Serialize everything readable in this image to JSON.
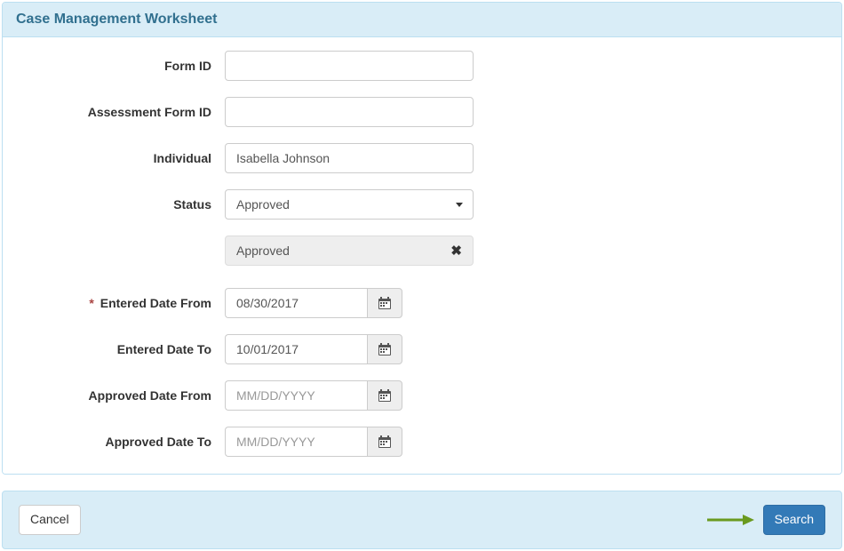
{
  "header": {
    "title": "Case Management Worksheet"
  },
  "fields": {
    "form_id": {
      "label": "Form ID",
      "value": ""
    },
    "assessment_form_id": {
      "label": "Assessment Form ID",
      "value": ""
    },
    "individual": {
      "label": "Individual",
      "value": "Isabella Johnson"
    },
    "status": {
      "label": "Status",
      "selected": "Approved",
      "chip": "Approved"
    },
    "entered_date_from": {
      "label": "Entered Date From",
      "value": "08/30/2017",
      "required": true
    },
    "entered_date_to": {
      "label": "Entered Date To",
      "value": "10/01/2017"
    },
    "approved_date_from": {
      "label": "Approved Date From",
      "placeholder": "MM/DD/YYYY",
      "value": ""
    },
    "approved_date_to": {
      "label": "Approved Date To",
      "placeholder": "MM/DD/YYYY",
      "value": ""
    }
  },
  "buttons": {
    "cancel": "Cancel",
    "search": "Search"
  },
  "symbols": {
    "required": "*"
  }
}
